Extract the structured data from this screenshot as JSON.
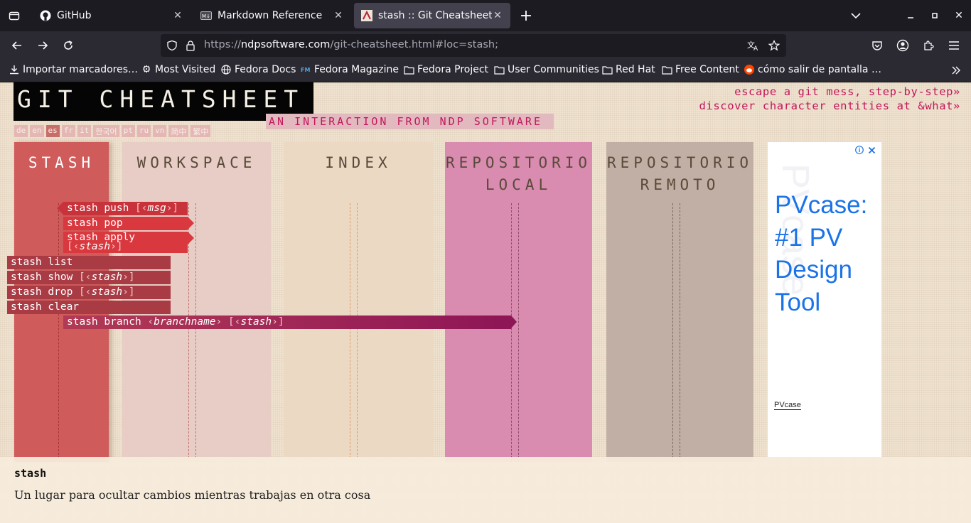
{
  "browser": {
    "tabs": [
      {
        "title": "GitHub",
        "icon": "github-icon"
      },
      {
        "title": "Markdown Reference",
        "icon": "markdown-icon"
      },
      {
        "title": "stash :: Git Cheatsheet :: N",
        "icon": "ndp-icon",
        "active": true
      }
    ],
    "url_prefix": "https://",
    "url_domain": "ndpsoftware.com",
    "url_path": "/git-cheatsheet.html#loc=stash;",
    "bookmarks": [
      {
        "label": "Importar marcadores…",
        "icon": "import-icon"
      },
      {
        "label": "Most Visited",
        "icon": "gear-icon"
      },
      {
        "label": "Fedora Docs",
        "icon": "globe-icon"
      },
      {
        "label": "Fedora Magazine",
        "icon": "fm-icon"
      },
      {
        "label": "Fedora Project",
        "icon": "folder-icon"
      },
      {
        "label": "User Communities",
        "icon": "folder-icon"
      },
      {
        "label": "Red Hat",
        "icon": "folder-icon"
      },
      {
        "label": "Free Content",
        "icon": "folder-icon"
      },
      {
        "label": "cómo salir de pantalla …",
        "icon": "reddit-icon"
      }
    ]
  },
  "page": {
    "logo": "GIT CHEATSHEET",
    "subtitle": "AN INTERACTION FROM NDP SOFTWARE",
    "toplinks": [
      "escape a git mess, step-by-step»",
      "discover character entities at &what»"
    ],
    "languages": [
      "de",
      "en",
      "es",
      "fr",
      "it",
      "한국어",
      "pt",
      "ru",
      "vn",
      "简中",
      "繁中"
    ],
    "selected_language": "es",
    "columns": {
      "stash": "STASH",
      "workspace": "WORKSPACE",
      "index": "INDEX",
      "local": "REPOSITORIO LOCAL",
      "remote": "REPOSITORIO REMOTO"
    },
    "commands": {
      "push": {
        "cmd": "stash push",
        "arg": "msg"
      },
      "pop": {
        "cmd": "stash pop"
      },
      "apply": {
        "cmd": "stash apply",
        "arg": "stash"
      },
      "list": {
        "cmd": "stash list"
      },
      "show": {
        "cmd": "stash show",
        "arg": "stash"
      },
      "drop": {
        "cmd": "stash drop",
        "arg": "stash"
      },
      "clear": {
        "cmd": "stash clear"
      },
      "branch": {
        "cmd": "stash branch",
        "arg1": "branchname",
        "arg2": "stash"
      }
    },
    "ad": {
      "headline": "PVcase: #1 PV Design Tool",
      "brand": "PVcase",
      "watermark": "PVcase"
    },
    "info": {
      "term": "stash",
      "description": "Un lugar para ocultar cambios mientras trabajas en otra cosa"
    }
  }
}
